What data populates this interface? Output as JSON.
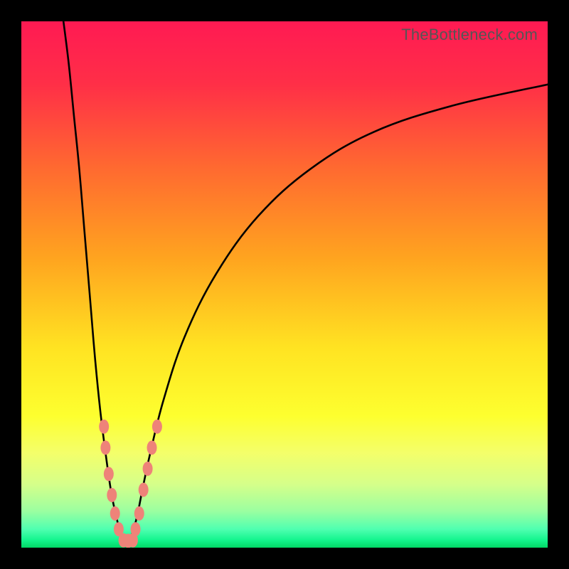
{
  "watermark": "TheBottleneck.com",
  "chart_data": {
    "type": "line",
    "title": "",
    "xlabel": "",
    "ylabel": "",
    "xlim": [
      0,
      100
    ],
    "ylim": [
      0,
      100
    ],
    "gradient_stops": [
      {
        "offset": 0,
        "color": "#ff1a53"
      },
      {
        "offset": 0.12,
        "color": "#ff2f47"
      },
      {
        "offset": 0.28,
        "color": "#ff6a30"
      },
      {
        "offset": 0.45,
        "color": "#ffa41f"
      },
      {
        "offset": 0.62,
        "color": "#ffe322"
      },
      {
        "offset": 0.75,
        "color": "#fdff2f"
      },
      {
        "offset": 0.82,
        "color": "#f4ff6a"
      },
      {
        "offset": 0.88,
        "color": "#d5ff8a"
      },
      {
        "offset": 0.93,
        "color": "#9cffa0"
      },
      {
        "offset": 0.965,
        "color": "#4fffb0"
      },
      {
        "offset": 0.985,
        "color": "#14f58e"
      },
      {
        "offset": 1.0,
        "color": "#02d765"
      }
    ],
    "series": [
      {
        "name": "left-branch",
        "points": [
          {
            "x": 8.0,
            "y": 100
          },
          {
            "x": 9.0,
            "y": 92
          },
          {
            "x": 10.0,
            "y": 82
          },
          {
            "x": 11.0,
            "y": 72
          },
          {
            "x": 12.0,
            "y": 60
          },
          {
            "x": 13.0,
            "y": 48
          },
          {
            "x": 14.0,
            "y": 36
          },
          {
            "x": 15.0,
            "y": 26
          },
          {
            "x": 16.0,
            "y": 18
          },
          {
            "x": 17.0,
            "y": 11
          },
          {
            "x": 18.0,
            "y": 6
          },
          {
            "x": 19.0,
            "y": 2.5
          },
          {
            "x": 20.0,
            "y": 0.5
          }
        ]
      },
      {
        "name": "right-branch",
        "points": [
          {
            "x": 20.0,
            "y": 0.5
          },
          {
            "x": 21.0,
            "y": 2.5
          },
          {
            "x": 22.0,
            "y": 6
          },
          {
            "x": 23.0,
            "y": 11
          },
          {
            "x": 24.5,
            "y": 18
          },
          {
            "x": 27.0,
            "y": 28
          },
          {
            "x": 31.0,
            "y": 40
          },
          {
            "x": 37.0,
            "y": 52
          },
          {
            "x": 45.0,
            "y": 63
          },
          {
            "x": 55.0,
            "y": 72
          },
          {
            "x": 67.0,
            "y": 79
          },
          {
            "x": 82.0,
            "y": 84
          },
          {
            "x": 100.0,
            "y": 88
          }
        ]
      }
    ],
    "markers": {
      "color": "#ee8379",
      "rx": 7,
      "ry": 10,
      "points": [
        {
          "x": 15.7,
          "y": 23
        },
        {
          "x": 16.0,
          "y": 19
        },
        {
          "x": 16.6,
          "y": 14
        },
        {
          "x": 17.2,
          "y": 10
        },
        {
          "x": 17.8,
          "y": 6.5
        },
        {
          "x": 18.5,
          "y": 3.5
        },
        {
          "x": 19.4,
          "y": 1.4
        },
        {
          "x": 20.3,
          "y": 1.3
        },
        {
          "x": 21.2,
          "y": 1.4
        },
        {
          "x": 21.7,
          "y": 3.5
        },
        {
          "x": 22.4,
          "y": 6.5
        },
        {
          "x": 23.2,
          "y": 11
        },
        {
          "x": 24.0,
          "y": 15
        },
        {
          "x": 24.8,
          "y": 19
        },
        {
          "x": 25.8,
          "y": 23
        }
      ]
    }
  }
}
